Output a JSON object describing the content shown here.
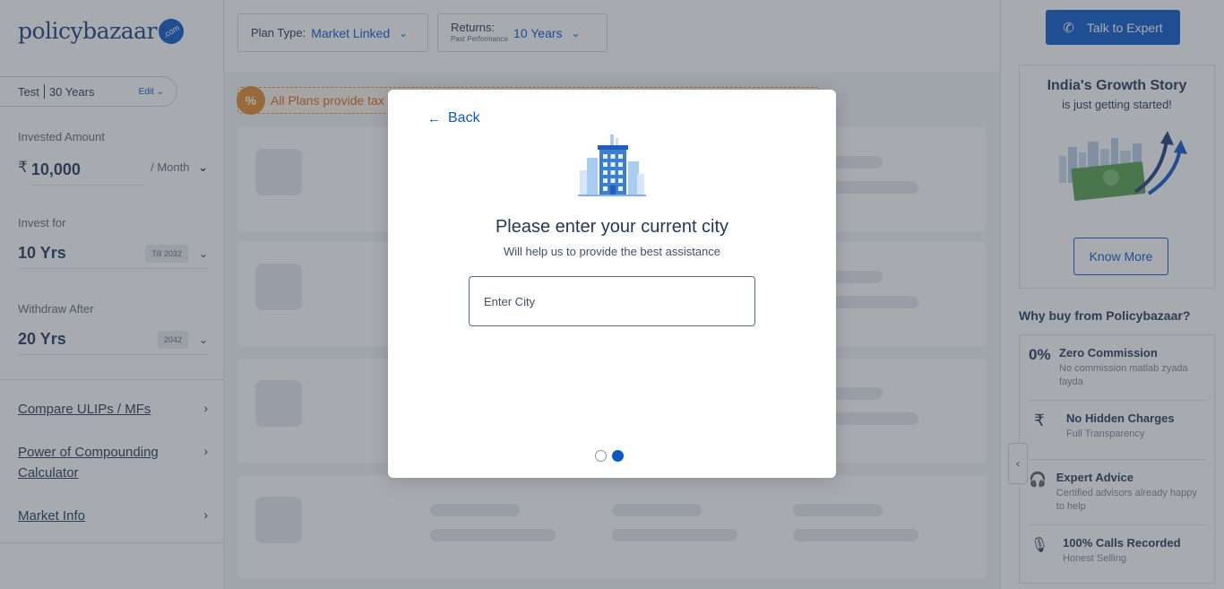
{
  "logo": {
    "text": "policybazaar",
    "badge": ".com"
  },
  "profile": {
    "name": "Test",
    "age": "30 Years",
    "edit_label": "Edit"
  },
  "invested": {
    "label": "Invested Amount",
    "currency": "₹",
    "amount": "10,000",
    "frequency": "/ Month"
  },
  "invest_for": {
    "label": "Invest for",
    "value": "10 Yrs",
    "tag": "Till 2032"
  },
  "withdraw_after": {
    "label": "Withdraw After",
    "value": "20 Yrs",
    "tag": "2042"
  },
  "side_links": [
    {
      "label": "Compare ULIPs / MFs"
    },
    {
      "label": "Power of Compounding Calculator"
    },
    {
      "label": "Market Info"
    }
  ],
  "filters": {
    "plan_type": {
      "label": "Plan Type:",
      "value": "Market Linked"
    },
    "returns": {
      "label": "Returns:",
      "sublabel": "Past Performance",
      "value": "10 Years"
    }
  },
  "tax_banner": {
    "text": "All Plans provide tax",
    "badge": "%"
  },
  "right": {
    "talk_button": "Talk to Expert",
    "growth_title": "India's Growth Story",
    "growth_sub": "is just getting started!",
    "know_more": "Know More",
    "why_title": "Why buy from Policybazaar?",
    "why_items": [
      {
        "icon": "zero-percent-icon",
        "glyph": "0%",
        "title": "Zero Commission",
        "desc": "No commission matlab zyada fayda"
      },
      {
        "icon": "no-rupee-icon",
        "glyph": "₹",
        "title": "No Hidden Charges",
        "desc": "Full Transparency"
      },
      {
        "icon": "headset-icon",
        "glyph": "🎧",
        "title": "Expert Advice",
        "desc": "Certified advisors already happy to help"
      },
      {
        "icon": "microphone-icon",
        "glyph": "🎙",
        "title": "100% Calls Recorded",
        "desc": "Honest Selling"
      }
    ]
  },
  "modal": {
    "back_label": "Back",
    "title": "Please enter your current city",
    "subtitle": "Will help us to provide the best assistance",
    "input_placeholder": "Enter City",
    "input_value": "",
    "steps_total": 2,
    "step_current": 2
  },
  "colors": {
    "brand_blue": "#0a58ca",
    "text_dark": "#253858",
    "tax_orange": "#e38b2c",
    "overlay": "rgba(60,66,78,0.45)"
  }
}
